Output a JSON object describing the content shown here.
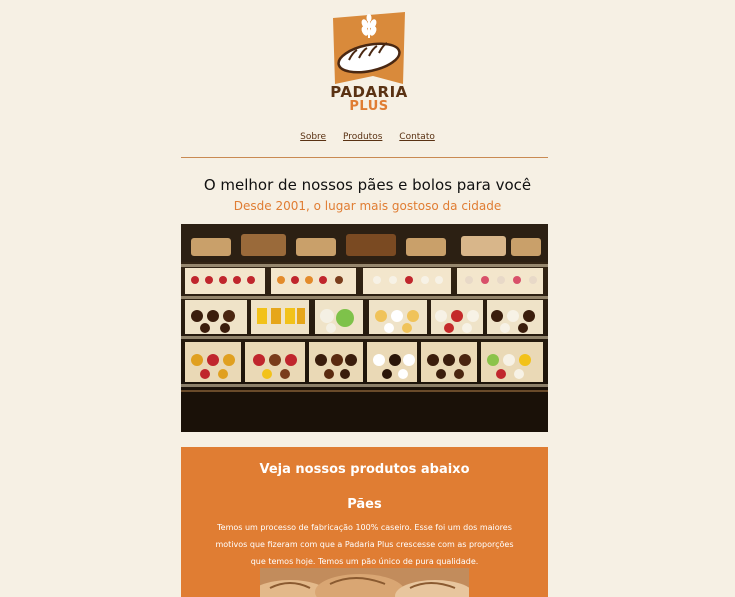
{
  "logo": {
    "line1": "PADARIA",
    "line2": "PLUS",
    "icon": "bread-icon",
    "accent": "#d98a3b"
  },
  "nav": {
    "sobre": "Sobre",
    "produtos": "Produtos",
    "contato": "Contato"
  },
  "hero": {
    "headline": "O melhor de nossos pães e bolos para você",
    "subheadline": "Desde 2001, o lugar mais gostoso da cidade"
  },
  "products": {
    "title": "Veja nossos produtos abaixo",
    "category_title": "Pães",
    "category_text": "Temos um processo de fabricação 100% caseiro. Esse foi um dos maiores motivos que fizeram com que a Padaria Plus crescesse com as proporções que temos hoje. Temos um pão único de pura qualidade."
  },
  "colors": {
    "background": "#f6f0e4",
    "primary": "#e07d33",
    "dark": "#5a3213"
  }
}
